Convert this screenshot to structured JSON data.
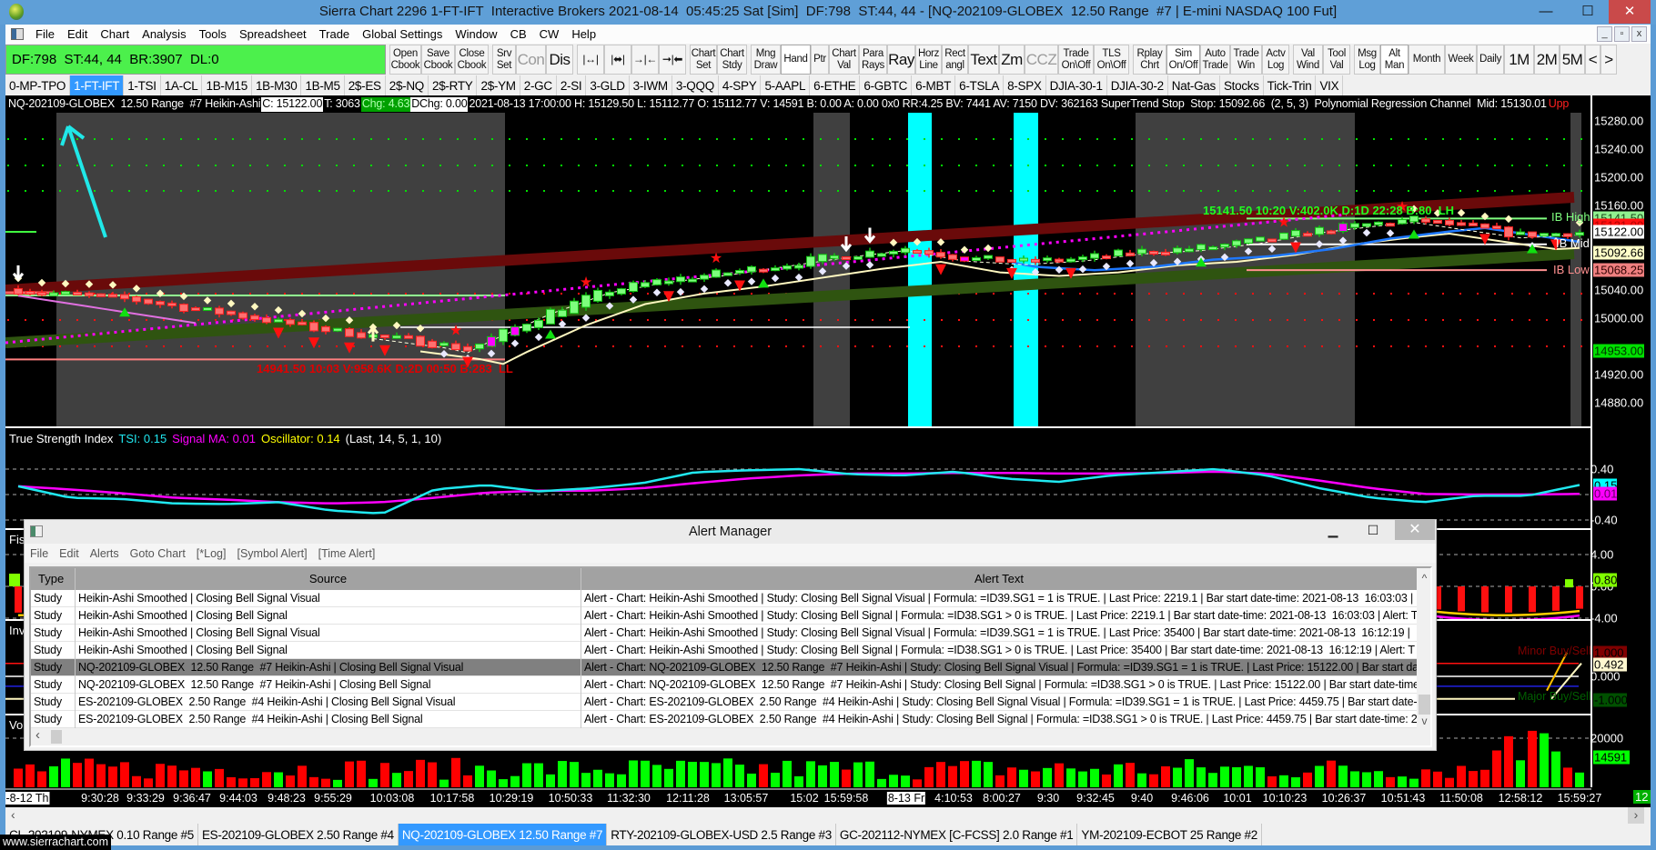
{
  "window": {
    "title": "Sierra Chart 2296 1-FT-IFT  Interactive Brokers 2021-08-14  05:45:25 Sat [Sim]  DF:798  ST:44, 44 - [NQ-202109-GLOBEX  12.50 Range  #7 | E-mini NASDAQ 100 Fut]",
    "min": "—",
    "max": "☐",
    "close": "✕"
  },
  "menu": [
    "File",
    "Edit",
    "Chart",
    "Analysis",
    "Tools",
    "Spreadsheet",
    "Trade",
    "Global Settings",
    "Window",
    "CB",
    "CW",
    "Help"
  ],
  "mdi": [
    "_",
    "▫",
    "x"
  ],
  "status_box": "DF:798  ST:44, 44  BR:3907  DL:0",
  "toolbar": [
    {
      "label": "Open\nCbook"
    },
    {
      "label": "Save\nCbook"
    },
    {
      "label": "Close\nCbook"
    },
    {
      "label": "Srv\nSet"
    },
    {
      "label": "Con",
      "big": true,
      "disabled": true
    },
    {
      "label": "Dis",
      "big": true
    },
    {
      "icon": "expand-bars-icon"
    },
    {
      "icon": "expand-bars-bold-icon"
    },
    {
      "icon": "compress-bars-icon"
    },
    {
      "icon": "compress-bars-bold-icon"
    },
    {
      "label": "Chart\nSet"
    },
    {
      "label": "Chart\nStdy"
    },
    {
      "label": "Mng\nDraw"
    },
    {
      "label": "Hand",
      "pressed": true
    },
    {
      "label": "Ptr"
    },
    {
      "label": "Chart\nVal"
    },
    {
      "label": "Para\nRays"
    },
    {
      "label": "Ray",
      "big": true
    },
    {
      "label": "Horz\nLine"
    },
    {
      "label": "Rect\nangl"
    },
    {
      "label": "Text",
      "big": true
    },
    {
      "label": "Zm",
      "big": true
    },
    {
      "label": "CCZ",
      "big": true,
      "disabled": true
    },
    {
      "label": "Trade\nOn\\Off"
    },
    {
      "label": "TLS\nOn\\Off"
    },
    {
      "label": "Rplay\nChrt"
    },
    {
      "label": "Sim\nOn/Off",
      "pressed": true
    },
    {
      "label": "Auto\nTrade"
    },
    {
      "label": "Trade\nWin"
    },
    {
      "label": "Actv\nLog"
    },
    {
      "label": "Val\nWind"
    },
    {
      "label": "Tool\nVal"
    },
    {
      "label": "Msg\nLog"
    },
    {
      "label": "Alt\nMan",
      "pressed": true
    },
    {
      "label": "Month"
    },
    {
      "label": "Week"
    },
    {
      "label": "Daily"
    },
    {
      "label": "1M",
      "big": true
    },
    {
      "label": "2M",
      "big": true
    },
    {
      "label": "5M",
      "big": true
    },
    {
      "label": "<",
      "big": true
    },
    {
      "label": ">",
      "big": true
    }
  ],
  "chartbook_tabs": {
    "active": 1,
    "items": [
      "0-MP-TPO",
      "1-FT-IFT",
      "1-TSI",
      "1A-CL",
      "1B-M15",
      "1B-M30",
      "1B-M5",
      "2$-ES",
      "2$-NQ",
      "2$-RTY",
      "2$-YM",
      "2-GC",
      "2-SI",
      "3-GLD",
      "3-IWM",
      "3-QQQ",
      "4-SPY",
      "5-AAPL",
      "6-ETHE",
      "6-GBTC",
      "6-MBT",
      "6-TSLA",
      "8-SPX",
      "DJIA-30-1",
      "DJIA-30-2",
      "Nat-Gas",
      "Stocks",
      "Tick-Trin",
      "VIX"
    ]
  },
  "chart": {
    "header": {
      "symbol": "NQ-202109-GLOBEX  12.50 Range  #7 Heikin-Ashi",
      "close": "C: 15122.00",
      "trades": "T: 3063",
      "chg": "Chg: 4.63",
      "dchg": "DChg: 0.00",
      "rest": "2021-08-13 17:00:00 H: 15129.50 L: 15112.77 O: 15112.77 V: 14591 B: 0.00 A: 0.00 0x0 RR:4.25 BV: 7441 AV: 7150 DV: 362163 SuperTrend Stop  Stop: 15092.66  (2, 5, 3)  Polynomial Regression Channel  Mid: 15130.01",
      "upper": "Upp"
    },
    "price_axis": [
      15280,
      15240,
      15200,
      15160,
      15040,
      15000,
      14920,
      14880
    ],
    "price_axis_labels": [
      "15280.00",
      "15240.00",
      "15200.00",
      "15160.00",
      "15040.00",
      "15000.00",
      "14920.00",
      "14880.00"
    ],
    "price_markers": [
      {
        "text": "15141.50",
        "price": 15141.5,
        "bg": "#90f090",
        "fg": "#1a4a1a"
      },
      {
        "text": "15131.00",
        "price": 15131,
        "bg": "#ff1010",
        "fg": "#b00000"
      },
      {
        "text": "15122.00",
        "price": 15122,
        "bg": "#ffffff",
        "fg": "#000000"
      },
      {
        "text": "15092.66",
        "price": 15092.66,
        "bg": "#ffffc8",
        "fg": "#000000"
      },
      {
        "text": "15068.25",
        "price": 15068.25,
        "bg": "#f08080",
        "fg": "#300000"
      },
      {
        "text": "14953.00",
        "price": 14953,
        "bg": "#00e000",
        "fg": "#003000"
      }
    ],
    "levels": {
      "ib_high": 15141.5,
      "ib_mid": 15104.9,
      "ib_low": 15068.25,
      "swing_low": 14941.5
    },
    "annotations": {
      "swing_high_text": "15141.50 10:20 V:402.0K D:1D 22:28 B:80  LH",
      "swing_low_text": "14941.50 10:03 V:958.6K D:2D 00:50 B:283  LL",
      "ib_high": "IB High",
      "ib_mid": "IB Mid",
      "ib_low": "IB Low"
    },
    "price_path": [
      [
        0,
        15040
      ],
      [
        10,
        15025
      ],
      [
        20,
        15000
      ],
      [
        25,
        14985
      ],
      [
        30,
        14975
      ],
      [
        36,
        14962
      ],
      [
        38,
        14955
      ],
      [
        40,
        14972
      ],
      [
        45,
        15010
      ],
      [
        50,
        15040
      ],
      [
        55,
        15055
      ],
      [
        60,
        15065
      ],
      [
        70,
        15090
      ],
      [
        75,
        15100
      ],
      [
        80,
        15085
      ],
      [
        85,
        15080
      ],
      [
        90,
        15085
      ],
      [
        95,
        15095
      ],
      [
        100,
        15100
      ],
      [
        105,
        15110
      ],
      [
        110,
        15125
      ],
      [
        115,
        15135
      ],
      [
        118,
        15140
      ],
      [
        122,
        15130
      ],
      [
        127,
        15118
      ],
      [
        132,
        15122
      ]
    ],
    "colors": {
      "up": "#7dff7d",
      "down": "#ff7070",
      "session_shade": "#404040",
      "highlight": "#00ffff"
    }
  },
  "tsi": {
    "title": "True Strength Index",
    "tsi": "TSI: 0.15",
    "signal": "Signal MA: 0.01",
    "osc": "Oscillator: 0.14",
    "params": "(Last, 14, 5, 1, 10)",
    "axis": [
      "0.40",
      "-0.40"
    ],
    "axis_values": [
      0.4,
      -0.4
    ],
    "tsi_marker": "0.15",
    "signal_marker": "0.01",
    "tsi_values": [
      0.13,
      -0.05,
      -0.07,
      -0.14,
      -0.15,
      -0.12,
      -0.25,
      -0.3,
      0.08,
      0.15,
      0.05,
      0.1,
      0.18,
      0.35,
      0.38,
      0.4,
      0.32,
      0.3,
      0.36,
      0.25,
      0.2,
      0.3,
      0.35,
      0.4,
      0.3,
      0.1,
      -0.05,
      -0.12,
      -0.02,
      -0.02,
      0.15
    ],
    "signal_values": [
      0.13,
      0.08,
      0.02,
      -0.05,
      -0.08,
      -0.12,
      -0.14,
      -0.12,
      -0.05,
      0.03,
      0.06,
      0.06,
      0.1,
      0.18,
      0.25,
      0.3,
      0.33,
      0.33,
      0.34,
      0.34,
      0.33,
      0.33,
      0.34,
      0.36,
      0.33,
      0.22,
      0.1,
      0.01,
      0.0,
      0.0,
      0.01
    ]
  },
  "fisher": {
    "label": "Fis",
    "axis": [
      "4.00",
      "0.00",
      "-4.00"
    ],
    "axis_values": [
      4,
      0,
      -4
    ],
    "marker": "0.80"
  },
  "inv": {
    "label": "Inv",
    "minor": "Minor Buy/Sell",
    "major": "Major Buy/Sell",
    "markers": [
      "1.000",
      "0.492",
      "0.000",
      "-1.000"
    ],
    "marker_values": [
      1,
      0.492,
      0,
      -1
    ]
  },
  "volume": {
    "label": "Vo",
    "axis": "20000",
    "axis_value": 20000,
    "marker": "14591"
  },
  "time_axis": [
    {
      "t": "-8-12 Th",
      "hl": true
    },
    {
      "t": "9:30:28"
    },
    {
      "t": "9:33:29"
    },
    {
      "t": "9:36:47"
    },
    {
      "t": "9:44:03"
    },
    {
      "t": "9:48:23"
    },
    {
      "t": "9:55:29"
    },
    {
      "t": "10:03:08"
    },
    {
      "t": "10:17:58"
    },
    {
      "t": "10:29:19"
    },
    {
      "t": "10:50:33"
    },
    {
      "t": "11:32:30"
    },
    {
      "t": "12:11:28"
    },
    {
      "t": "13:05:57"
    },
    {
      "t": "15:02"
    },
    {
      "t": "15:59:58"
    },
    {
      "t": "8-13 Fr",
      "hl": true
    },
    {
      "t": "4:10:53"
    },
    {
      "t": "8:00:27"
    },
    {
      "t": "9:30"
    },
    {
      "t": "9:32:45"
    },
    {
      "t": "9:40"
    },
    {
      "t": "9:46:06"
    },
    {
      "t": "10:01"
    },
    {
      "t": "10:10:23"
    },
    {
      "t": "10:26:37"
    },
    {
      "t": "10:51:43"
    },
    {
      "t": "11:50:08"
    },
    {
      "t": "12:58:12"
    },
    {
      "t": "15:59:27"
    }
  ],
  "time_axis_right": "12 E",
  "scroll": {
    "left": "‹",
    "right": "›"
  },
  "sheet_tabs": {
    "active": 2,
    "items": [
      "CL-202109-NYMEX  0.10 Range  #5",
      "ES-202109-GLOBEX  2.50 Range  #4",
      "NQ-202109-GLOBEX  12.50 Range  #7",
      "RTY-202109-GLOBEX-USD  2.5 Range  #3",
      "GC-202112-NYMEX [C-FCSS]  2.0 Range  #1",
      "YM-202109-ECBOT  25 Range  #2"
    ]
  },
  "watermark": "www.sierrachart.com",
  "alert_manager": {
    "title": "Alert Manager",
    "menu": [
      "File",
      "Edit",
      "Alerts",
      "Goto Chart",
      "[*Log]",
      "[Symbol Alert]",
      "[Time Alert]"
    ],
    "columns": [
      "Type",
      "Source",
      "Alert Text"
    ],
    "selected": 4,
    "rows": [
      {
        "type": "Study",
        "source": "Heikin-Ashi Smoothed | Closing Bell Signal Visual",
        "text": "Alert - Chart: Heikin-Ashi Smoothed | Study: Closing Bell Signal Visual | Formula: =ID39.SG1 = 1 is TRUE. | Last Price: 2219.1 | Bar start date-time: 2021-08-13  16:03:03 |"
      },
      {
        "type": "Study",
        "source": "Heikin-Ashi Smoothed | Closing Bell Signal",
        "text": "Alert - Chart: Heikin-Ashi Smoothed | Study: Closing Bell Signal | Formula: =ID38.SG1 > 0 is TRUE. | Last Price: 2219.1 | Bar start date-time: 2021-08-13  16:03:03 | Alert: T"
      },
      {
        "type": "Study",
        "source": "Heikin-Ashi Smoothed | Closing Bell Signal Visual",
        "text": "Alert - Chart: Heikin-Ashi Smoothed | Study: Closing Bell Signal Visual | Formula: =ID39.SG1 = 1 is TRUE. | Last Price: 35400 | Bar start date-time: 2021-08-13  16:12:19 |"
      },
      {
        "type": "Study",
        "source": "Heikin-Ashi Smoothed | Closing Bell Signal",
        "text": "Alert - Chart: Heikin-Ashi Smoothed | Study: Closing Bell Signal | Formula: =ID38.SG1 > 0 is TRUE. | Last Price: 35400 | Bar start date-time: 2021-08-13  16:12:19 | Alert: T"
      },
      {
        "type": "Study",
        "source": "NQ-202109-GLOBEX  12.50 Range  #7 Heikin-Ashi | Closing Bell Signal Visual",
        "text": "Alert - Chart: NQ-202109-GLOBEX  12.50 Range  #7 Heikin-Ashi | Study: Closing Bell Signal Visual | Formula: =ID39.SG1 = 1 is TRUE. | Last Price: 15122.00 | Bar start da"
      },
      {
        "type": "Study",
        "source": "NQ-202109-GLOBEX  12.50 Range  #7 Heikin-Ashi | Closing Bell Signal",
        "text": "Alert - Chart: NQ-202109-GLOBEX  12.50 Range  #7 Heikin-Ashi | Study: Closing Bell Signal | Formula: =ID38.SG1 > 0 is TRUE. | Last Price: 15122.00 | Bar start date-time"
      },
      {
        "type": "Study",
        "source": "ES-202109-GLOBEX  2.50 Range  #4 Heikin-Ashi | Closing Bell Signal Visual",
        "text": "Alert - Chart: ES-202109-GLOBEX  2.50 Range  #4 Heikin-Ashi | Study: Closing Bell Signal Visual | Formula: =ID39.SG1 = 1 is TRUE. | Last Price: 4459.75 | Bar start date-t"
      },
      {
        "type": "Study",
        "source": "ES-202109-GLOBEX  2.50 Range  #4 Heikin-Ashi | Closing Bell Signal",
        "text": "Alert - Chart: ES-202109-GLOBEX  2.50 Range  #4 Heikin-Ashi | Study: Closing Bell Signal | Formula: =ID38.SG1 > 0 is TRUE. | Last Price: 4459.75 | Bar start date-time: 20"
      }
    ],
    "scroll_up": "^",
    "scroll_down": "v",
    "scroll_left": "‹"
  }
}
